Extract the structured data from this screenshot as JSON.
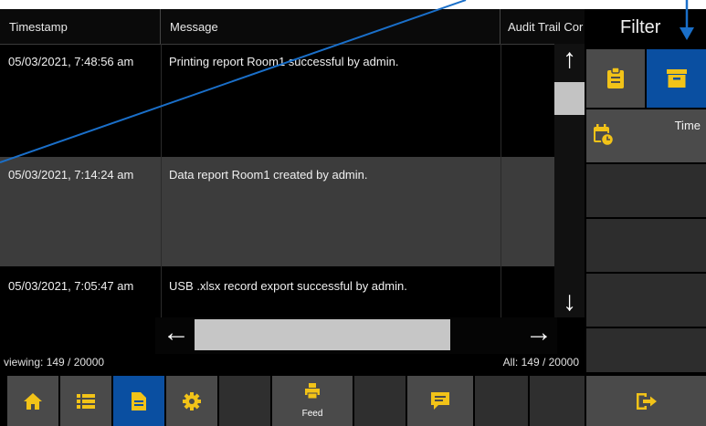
{
  "table": {
    "columns": [
      "Timestamp",
      "Message",
      "Audit Trail Cor"
    ],
    "rows": [
      {
        "timestamp": "05/03/2021, 7:48:56 am",
        "message": "Printing report Room1 successful by admin."
      },
      {
        "timestamp": "05/03/2021, 7:14:24 am",
        "message": "Data report Room1 created by admin."
      },
      {
        "timestamp": "05/03/2021, 7:05:47 am",
        "message": "USB .xlsx record export successful by admin."
      }
    ]
  },
  "scroll": {
    "up": "↑",
    "down": "↓",
    "left": "←",
    "right": "→"
  },
  "status": {
    "viewing": "viewing: 149 / 20000",
    "all": "All: 149 / 20000"
  },
  "filter": {
    "title": "Filter",
    "time_label": "Time"
  },
  "toolbar": {
    "feed_label": "Feed"
  },
  "colors": {
    "active": "#0a4fa1",
    "icon_yellow": "#f2c318",
    "button_gray": "#4a4a4a",
    "annotation": "#1a6fc9"
  },
  "icons": [
    "home-icon",
    "list-icon",
    "document-icon",
    "gear-icon",
    "feed-icon",
    "comment-icon",
    "logout-icon",
    "clipboard-icon",
    "archive-icon",
    "calendar-clock-icon"
  ]
}
